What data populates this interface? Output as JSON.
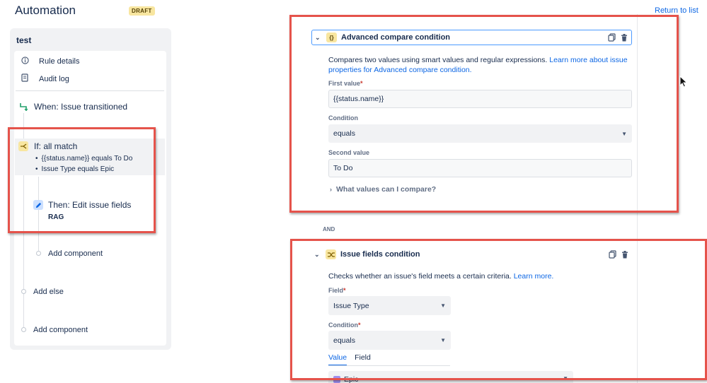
{
  "header": {
    "title": "Automation",
    "status_badge": "DRAFT",
    "return_link": "Return to list"
  },
  "rule": {
    "name": "test",
    "menu": [
      {
        "label": "Rule details",
        "icon": "info-icon"
      },
      {
        "label": "Audit log",
        "icon": "document-icon"
      }
    ],
    "trigger": {
      "label": "When: Issue transitioned",
      "icon": "transition-icon",
      "color": "#22a06b"
    },
    "condition": {
      "label": "If: all match",
      "icon": "branch-icon",
      "color": "#f8e6a0",
      "items": [
        "{{status.name}} equals To Do",
        "Issue Type equals Epic"
      ]
    },
    "action": {
      "label": "Then: Edit issue fields",
      "detail": "RAG",
      "icon": "pencil-icon",
      "color": "#cce0ff"
    },
    "add_component_inner": "Add component",
    "add_else": "Add else",
    "add_component_outer": "Add component"
  },
  "advanced_compare": {
    "title": "Advanced compare condition",
    "type_icon_text": "{}",
    "description": "Compares two values using smart values and regular expressions.",
    "learn_more": "Learn more about issue properties for Advanced compare condition.",
    "first_value_label": "First value",
    "first_value": "{{status.name}}",
    "condition_label": "Condition",
    "condition_value": "equals",
    "second_value_label": "Second value",
    "second_value": "To Do",
    "expander": "What values can I compare?"
  },
  "and_label": "AND",
  "issue_fields": {
    "title": "Issue fields condition",
    "description": "Checks whether an issue's field meets a certain criteria.",
    "learn_more": "Learn more.",
    "field_label": "Field",
    "field_value": "Issue Type",
    "condition_label": "Condition",
    "condition_value": "equals",
    "tabs": [
      "Value",
      "Field"
    ],
    "value_selected": "Epic",
    "value_icon_color": "#9f8fef"
  },
  "highlight_color": "#e5534b"
}
